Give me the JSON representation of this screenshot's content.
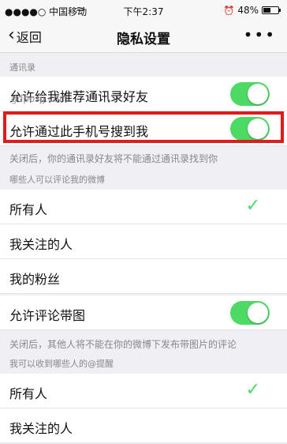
{
  "status": {
    "carrier": "●●●●○ 中国移动",
    "wifi": "≈",
    "time": "下午2:37",
    "alarm": "⏰",
    "battery": "48%",
    "battery_level": 0.48
  },
  "nav": {
    "back_label": "返回",
    "back_chev": "‹",
    "title": "隐私设置",
    "more": "•••"
  },
  "sections": {
    "contacts_title": "通讯录",
    "row_recommend": "允许给我推荐通讯录好友",
    "row_search_phone": "允许通过此手机号搜到我",
    "note_contacts": "关闭后，你的通讯录好友将不能通过通讯录找到你",
    "comment_who_title": "哪些人可以评论我的微博",
    "opt_all": "所有人",
    "opt_following": "我关注的人",
    "opt_fans": "我的粉丝",
    "row_comment_images": "允许评论带图",
    "note_comment_images": "关闭后，其他人将不能在你的微博下发布带图片的评论",
    "mention_title": "我可以收到哪些人的@提醒",
    "opt_all_2": "所有人",
    "opt_following_2": "我关注的人",
    "check": "✓"
  },
  "watermark": "gdposjj.com",
  "colors": {
    "toggle_on": "#4cd964",
    "highlight": "#e11b1b"
  }
}
